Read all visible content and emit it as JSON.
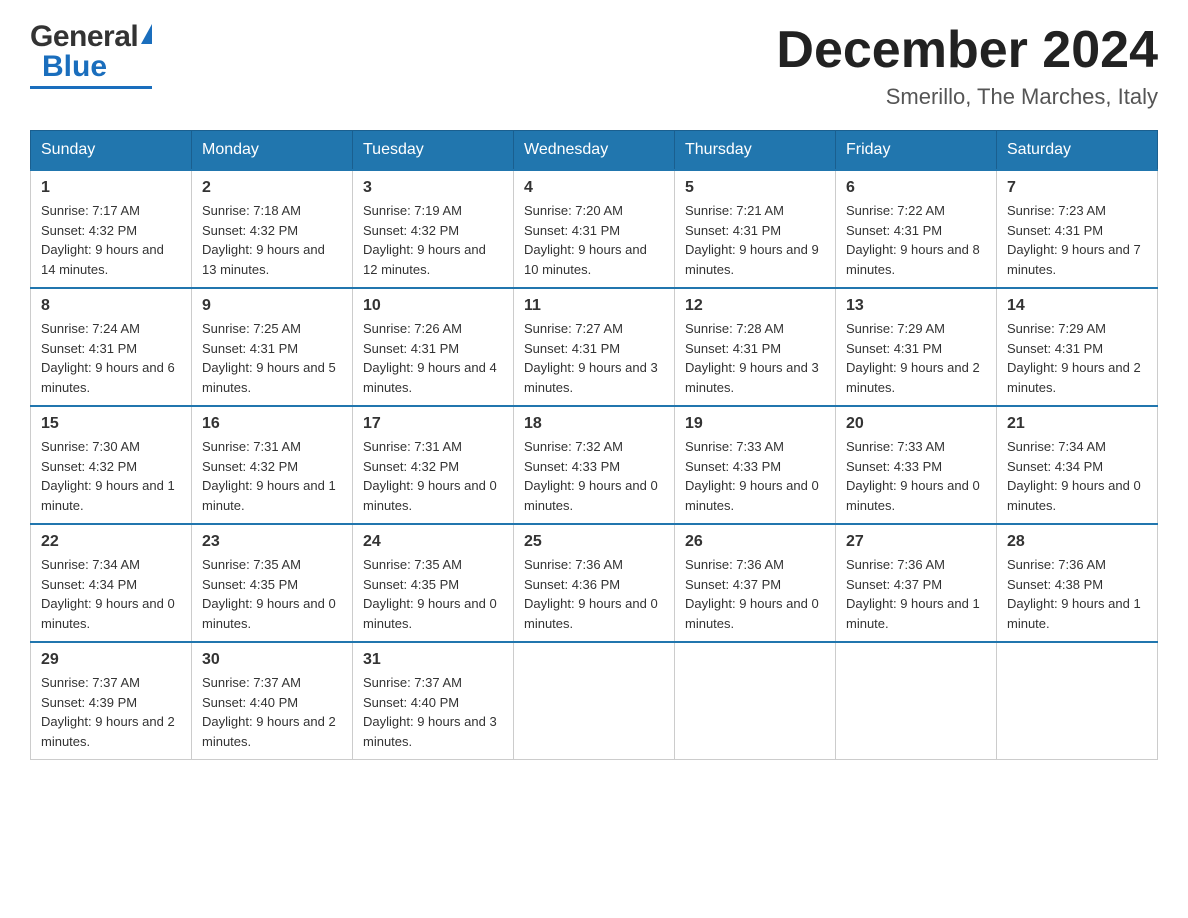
{
  "logo": {
    "general": "General",
    "blue": "Blue"
  },
  "title": "December 2024",
  "subtitle": "Smerillo, The Marches, Italy",
  "days_of_week": [
    "Sunday",
    "Monday",
    "Tuesday",
    "Wednesday",
    "Thursday",
    "Friday",
    "Saturday"
  ],
  "weeks": [
    [
      {
        "day": "1",
        "sunrise": "7:17 AM",
        "sunset": "4:32 PM",
        "daylight": "9 hours and 14 minutes."
      },
      {
        "day": "2",
        "sunrise": "7:18 AM",
        "sunset": "4:32 PM",
        "daylight": "9 hours and 13 minutes."
      },
      {
        "day": "3",
        "sunrise": "7:19 AM",
        "sunset": "4:32 PM",
        "daylight": "9 hours and 12 minutes."
      },
      {
        "day": "4",
        "sunrise": "7:20 AM",
        "sunset": "4:31 PM",
        "daylight": "9 hours and 10 minutes."
      },
      {
        "day": "5",
        "sunrise": "7:21 AM",
        "sunset": "4:31 PM",
        "daylight": "9 hours and 9 minutes."
      },
      {
        "day": "6",
        "sunrise": "7:22 AM",
        "sunset": "4:31 PM",
        "daylight": "9 hours and 8 minutes."
      },
      {
        "day": "7",
        "sunrise": "7:23 AM",
        "sunset": "4:31 PM",
        "daylight": "9 hours and 7 minutes."
      }
    ],
    [
      {
        "day": "8",
        "sunrise": "7:24 AM",
        "sunset": "4:31 PM",
        "daylight": "9 hours and 6 minutes."
      },
      {
        "day": "9",
        "sunrise": "7:25 AM",
        "sunset": "4:31 PM",
        "daylight": "9 hours and 5 minutes."
      },
      {
        "day": "10",
        "sunrise": "7:26 AM",
        "sunset": "4:31 PM",
        "daylight": "9 hours and 4 minutes."
      },
      {
        "day": "11",
        "sunrise": "7:27 AM",
        "sunset": "4:31 PM",
        "daylight": "9 hours and 3 minutes."
      },
      {
        "day": "12",
        "sunrise": "7:28 AM",
        "sunset": "4:31 PM",
        "daylight": "9 hours and 3 minutes."
      },
      {
        "day": "13",
        "sunrise": "7:29 AM",
        "sunset": "4:31 PM",
        "daylight": "9 hours and 2 minutes."
      },
      {
        "day": "14",
        "sunrise": "7:29 AM",
        "sunset": "4:31 PM",
        "daylight": "9 hours and 2 minutes."
      }
    ],
    [
      {
        "day": "15",
        "sunrise": "7:30 AM",
        "sunset": "4:32 PM",
        "daylight": "9 hours and 1 minute."
      },
      {
        "day": "16",
        "sunrise": "7:31 AM",
        "sunset": "4:32 PM",
        "daylight": "9 hours and 1 minute."
      },
      {
        "day": "17",
        "sunrise": "7:31 AM",
        "sunset": "4:32 PM",
        "daylight": "9 hours and 0 minutes."
      },
      {
        "day": "18",
        "sunrise": "7:32 AM",
        "sunset": "4:33 PM",
        "daylight": "9 hours and 0 minutes."
      },
      {
        "day": "19",
        "sunrise": "7:33 AM",
        "sunset": "4:33 PM",
        "daylight": "9 hours and 0 minutes."
      },
      {
        "day": "20",
        "sunrise": "7:33 AM",
        "sunset": "4:33 PM",
        "daylight": "9 hours and 0 minutes."
      },
      {
        "day": "21",
        "sunrise": "7:34 AM",
        "sunset": "4:34 PM",
        "daylight": "9 hours and 0 minutes."
      }
    ],
    [
      {
        "day": "22",
        "sunrise": "7:34 AM",
        "sunset": "4:34 PM",
        "daylight": "9 hours and 0 minutes."
      },
      {
        "day": "23",
        "sunrise": "7:35 AM",
        "sunset": "4:35 PM",
        "daylight": "9 hours and 0 minutes."
      },
      {
        "day": "24",
        "sunrise": "7:35 AM",
        "sunset": "4:35 PM",
        "daylight": "9 hours and 0 minutes."
      },
      {
        "day": "25",
        "sunrise": "7:36 AM",
        "sunset": "4:36 PM",
        "daylight": "9 hours and 0 minutes."
      },
      {
        "day": "26",
        "sunrise": "7:36 AM",
        "sunset": "4:37 PM",
        "daylight": "9 hours and 0 minutes."
      },
      {
        "day": "27",
        "sunrise": "7:36 AM",
        "sunset": "4:37 PM",
        "daylight": "9 hours and 1 minute."
      },
      {
        "day": "28",
        "sunrise": "7:36 AM",
        "sunset": "4:38 PM",
        "daylight": "9 hours and 1 minute."
      }
    ],
    [
      {
        "day": "29",
        "sunrise": "7:37 AM",
        "sunset": "4:39 PM",
        "daylight": "9 hours and 2 minutes."
      },
      {
        "day": "30",
        "sunrise": "7:37 AM",
        "sunset": "4:40 PM",
        "daylight": "9 hours and 2 minutes."
      },
      {
        "day": "31",
        "sunrise": "7:37 AM",
        "sunset": "4:40 PM",
        "daylight": "9 hours and 3 minutes."
      },
      null,
      null,
      null,
      null
    ]
  ],
  "labels": {
    "sunrise": "Sunrise:",
    "sunset": "Sunset:",
    "daylight": "Daylight:"
  }
}
